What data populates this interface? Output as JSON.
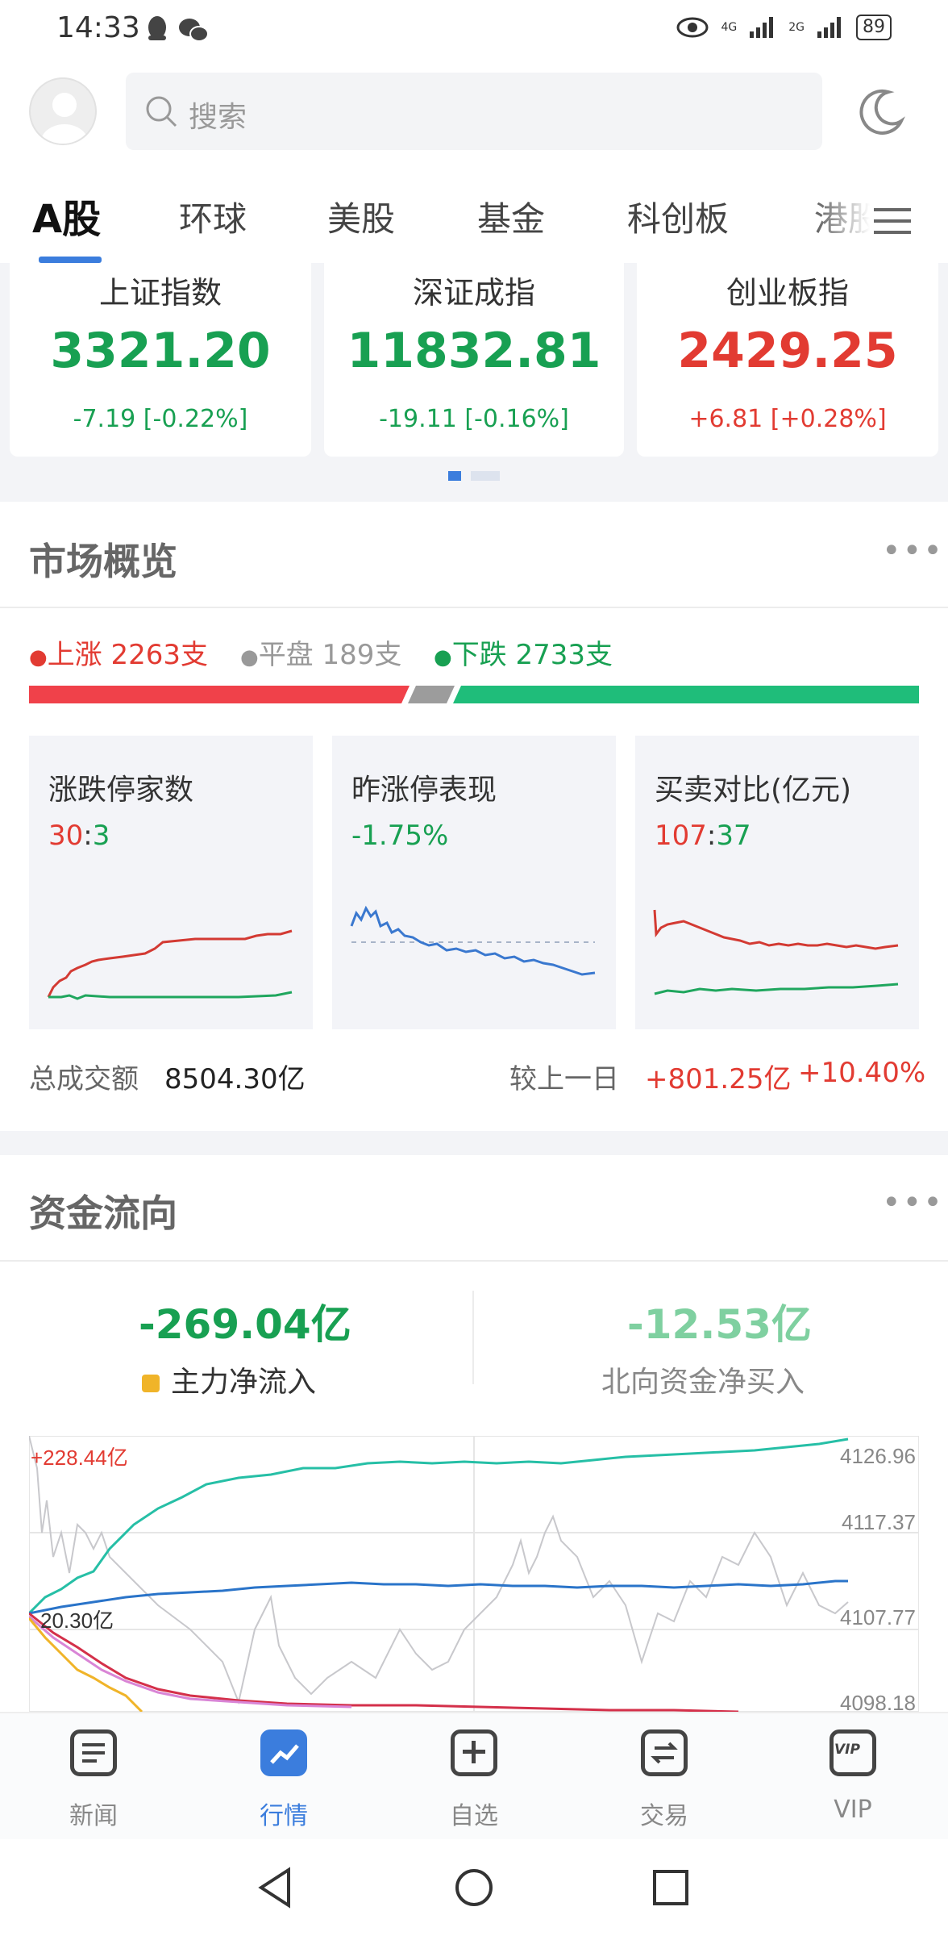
{
  "status_bar": {
    "time": "14:33",
    "net1": "4G",
    "net2": "2G",
    "battery": "89"
  },
  "header": {
    "search_placeholder": "搜索"
  },
  "tabs": [
    {
      "label": "A股"
    },
    {
      "label": "环球"
    },
    {
      "label": "美股"
    },
    {
      "label": "基金"
    },
    {
      "label": "科创板"
    },
    {
      "label": "港股"
    }
  ],
  "indices": [
    {
      "name": "上证指数",
      "value": "3321.20",
      "change": "-7.19 [-0.22%]"
    },
    {
      "name": "深证成指",
      "value": "11832.81",
      "change": "-19.11 [-0.16%]"
    },
    {
      "name": "创业板指",
      "value": "2429.25",
      "change": "+6.81 [+0.28%]"
    }
  ],
  "market_overview": {
    "title": "市场概览",
    "more": "•••",
    "up": "上涨 2263支",
    "flat": "平盘 189支",
    "down": "下跌 2733支",
    "ratio": {
      "up": 2263,
      "flat": 189,
      "down": 2733
    },
    "cards": [
      {
        "title": "涨跌停家数",
        "val_a": "30",
        "sep": ":",
        "val_b": "3"
      },
      {
        "title": "昨涨停表现",
        "value": "-1.75%"
      },
      {
        "title": "买卖对比(亿元)",
        "val_a": "107",
        "sep": ":",
        "val_b": "37"
      }
    ],
    "turnover_label": "总成交额",
    "turnover_value": "8504.30亿",
    "compare_label": "较上一日",
    "compare_amount": "+801.25亿",
    "compare_pct": "+10.40%"
  },
  "capital_flow": {
    "title": "资金流向",
    "more": "•••",
    "main_value": "-269.04亿",
    "main_label": "主力净流入",
    "north_value": "-12.53亿",
    "north_label": "北向资金净买入",
    "chart_top_label": "+228.44亿",
    "chart_mid_label": "20.30亿",
    "y_labels": [
      "4126.96",
      "4117.37",
      "4107.77",
      "4098.18"
    ]
  },
  "bottom_nav": [
    {
      "label": "新闻"
    },
    {
      "label": "行情"
    },
    {
      "label": "自选"
    },
    {
      "label": "交易"
    },
    {
      "label": "VIP"
    }
  ],
  "colors": {
    "up": "#e23b32",
    "down": "#18a052",
    "accent": "#3b7ddd",
    "gold": "#f0b429"
  }
}
